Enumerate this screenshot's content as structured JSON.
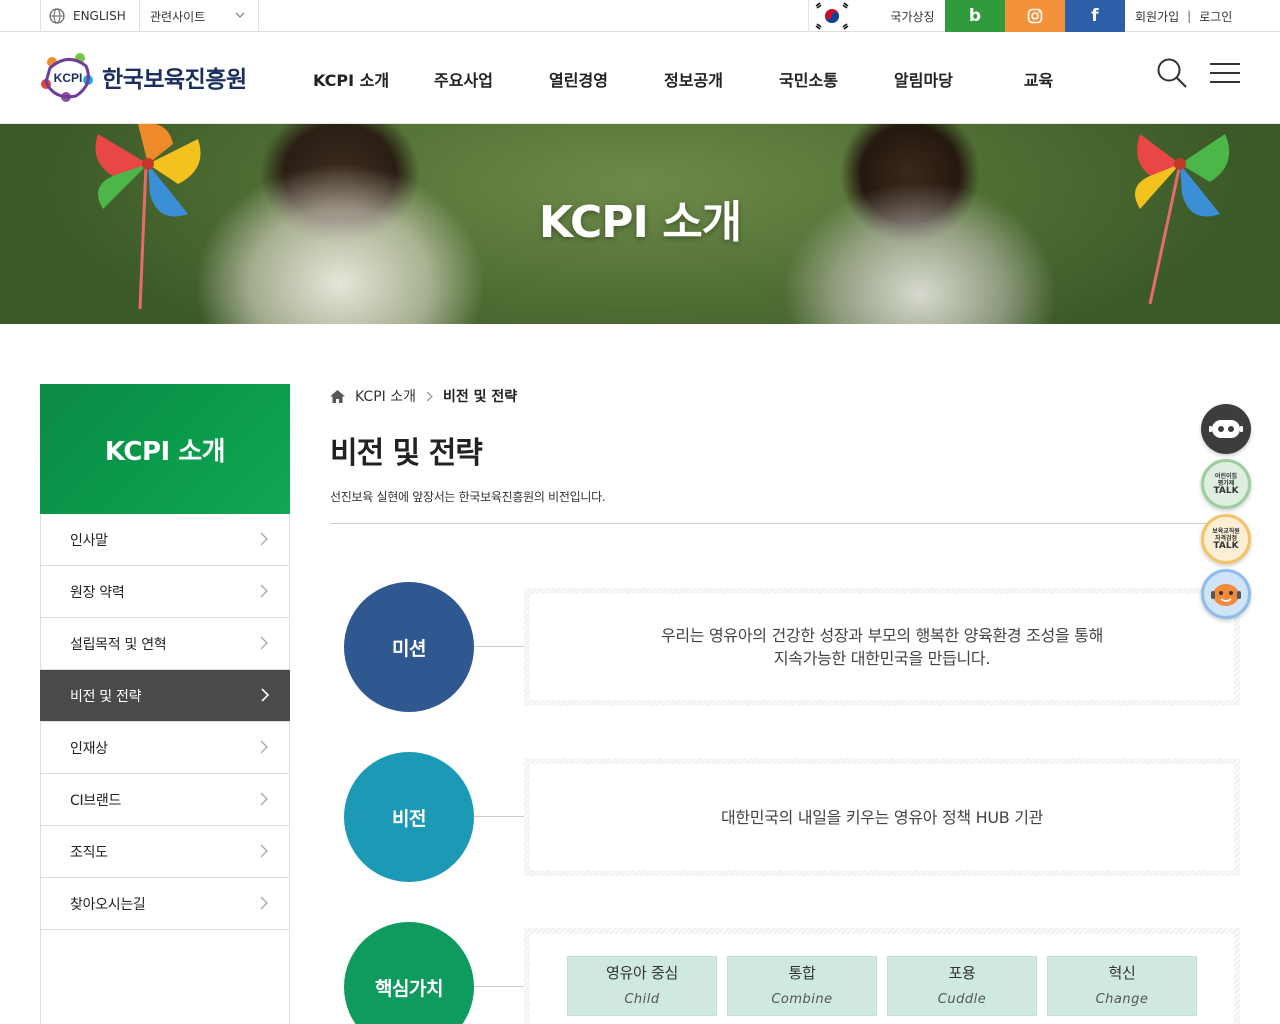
{
  "topbar": {
    "english_label": "ENGLISH",
    "related_label": "관련사이트",
    "national_symbol_label": "국가상징",
    "member": {
      "join_label": "회원가입",
      "separator": "|",
      "login_label": "로그인"
    }
  },
  "header": {
    "logo_mark_text": "KCPI",
    "logo_name": "한국보육진흥원",
    "nav": [
      "KCPI 소개",
      "주요사업",
      "열린경영",
      "정보공개",
      "국민소통",
      "알림마당",
      "교육"
    ]
  },
  "visual": {
    "title": "KCPI 소개"
  },
  "lnb": {
    "title": "KCPI 소개",
    "items": [
      {
        "label": "인사말",
        "active": false
      },
      {
        "label": "원장 약력",
        "active": false
      },
      {
        "label": "설립목적 및 연혁",
        "active": false
      },
      {
        "label": "비전 및 전략",
        "active": true
      },
      {
        "label": "인재상",
        "active": false
      },
      {
        "label": "CI브랜드",
        "active": false
      },
      {
        "label": "조직도",
        "active": false
      },
      {
        "label": "찾아오시는길",
        "active": false
      }
    ]
  },
  "content": {
    "breadcrumb": {
      "parent": "KCPI 소개",
      "current": "비전 및 전략"
    },
    "title": "비전 및 전략",
    "description": "선진보육 실현에 앞장서는 한국보육진흥원의 비전입니다.",
    "mission": {
      "label": "미션",
      "line1": "우리는 영유아의 건강한 성장과 부모의 행복한 양육환경 조성을 통해",
      "line2": "지속가능한 대한민국을 만듭니다."
    },
    "vision": {
      "label": "비전",
      "text": "대한민국의 내일을 키우는 영유아 정책 HUB 기관"
    },
    "core_values": {
      "label": "핵심가치",
      "items": [
        {
          "ko": "영유아 중심",
          "en": "Child"
        },
        {
          "ko": "통합",
          "en": "Combine"
        },
        {
          "ko": "포용",
          "en": "Cuddle"
        },
        {
          "ko": "혁신",
          "en": "Change"
        }
      ]
    }
  },
  "quick": {
    "talk1_line1": "어린이집",
    "talk1_line2": "평가제",
    "talk1_line3": "TALK",
    "talk2_line1": "보육교직원",
    "talk2_line2": "자격검정",
    "talk2_line3": "TALK"
  },
  "colors": {
    "mission": "#2f5890",
    "vision": "#1c9ab5",
    "core_values": "#0f9a5e",
    "lnb_head": "#0a9b4c",
    "lnb_active": "#4a4a4a",
    "blog": "#2f9b3c",
    "instagram": "#f5913a",
    "facebook": "#2c5fa8",
    "value_card": "#cfe9df"
  }
}
